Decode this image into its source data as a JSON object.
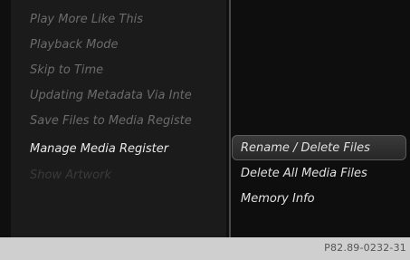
{
  "menu": {
    "items": [
      {
        "label": "Play More Like This"
      },
      {
        "label": "Playback Mode"
      },
      {
        "label": "Skip to Time"
      },
      {
        "label": "Updating Metadata Via Inte"
      },
      {
        "label": "Save Files to Media Registe"
      },
      {
        "label": "Manage Media Register"
      },
      {
        "label": "Show Artwork"
      }
    ],
    "active_index": 5
  },
  "submenu": {
    "items": [
      {
        "label": "Rename / Delete Files"
      },
      {
        "label": "Delete All Media Files"
      },
      {
        "label": "Memory Info"
      }
    ],
    "selected_index": 0
  },
  "footer": {
    "code": "P82.89-0232-31"
  }
}
